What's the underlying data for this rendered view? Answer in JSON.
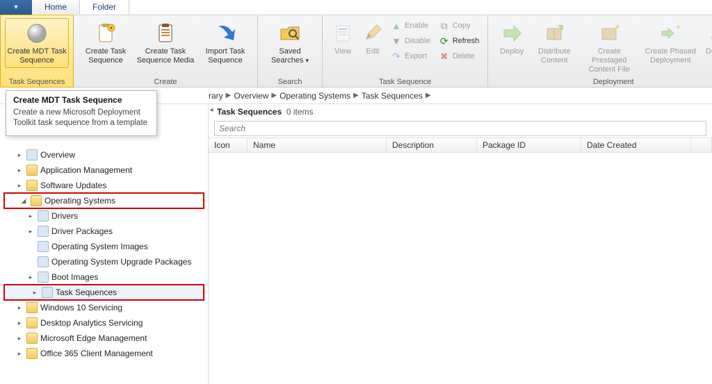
{
  "tabs": {
    "home": "Home",
    "folder": "Folder"
  },
  "ribbon": {
    "groups": {
      "task_sequences": "Task Sequences",
      "create": "Create",
      "search": "Search",
      "task_sequence": "Task Sequence",
      "deployment": "Deployment"
    },
    "buttons": {
      "create_mdt": "Create MDT Task Sequence",
      "create_ts": "Create Task Sequence",
      "create_media": "Create Task Sequence Media",
      "import_ts": "Import Task Sequence",
      "saved_searches": "Saved Searches",
      "view": "View",
      "edit": "Edit",
      "enable": "Enable",
      "disable": "Disable",
      "export": "Export",
      "copy": "Copy",
      "refresh": "Refresh",
      "delete": "Delete",
      "deploy": "Deploy",
      "distribute": "Distribute Content",
      "prestaged": "Create Prestaged Content File",
      "phased": "Create Phased Deployment",
      "debug": "Debug"
    }
  },
  "breadcrumb": [
    "rary",
    "Overview",
    "Operating Systems",
    "Task Sequences"
  ],
  "tooltip": {
    "title": "Create MDT Task Sequence",
    "body": "Create a new Microsoft Deployment Toolkit task sequence from a template"
  },
  "nav": {
    "items": [
      {
        "label": "Overview",
        "depth": 1,
        "icon": "node",
        "exp": "▸"
      },
      {
        "label": "Application Management",
        "depth": 1,
        "icon": "folder",
        "exp": "▸"
      },
      {
        "label": "Software Updates",
        "depth": 1,
        "icon": "folder",
        "exp": "▸"
      },
      {
        "label": "Operating Systems",
        "depth": 1,
        "icon": "folder",
        "exp": "◢",
        "red": true
      },
      {
        "label": "Drivers",
        "depth": 2,
        "icon": "node",
        "exp": "▸"
      },
      {
        "label": "Driver Packages",
        "depth": 2,
        "icon": "node",
        "exp": "▸"
      },
      {
        "label": "Operating System Images",
        "depth": 2,
        "icon": "node",
        "exp": ""
      },
      {
        "label": "Operating System Upgrade Packages",
        "depth": 2,
        "icon": "node",
        "exp": ""
      },
      {
        "label": "Boot Images",
        "depth": 2,
        "icon": "node",
        "exp": "▸"
      },
      {
        "label": "Task Sequences",
        "depth": 2,
        "icon": "node",
        "exp": "▸",
        "selected": true,
        "red": true
      },
      {
        "label": "Windows 10 Servicing",
        "depth": 1,
        "icon": "folder",
        "exp": "▸"
      },
      {
        "label": "Desktop Analytics Servicing",
        "depth": 1,
        "icon": "folder",
        "exp": "▸"
      },
      {
        "label": "Microsoft Edge Management",
        "depth": 1,
        "icon": "folder",
        "exp": "▸"
      },
      {
        "label": "Office 365 Client Management",
        "depth": 1,
        "icon": "folder",
        "exp": "▸"
      }
    ]
  },
  "list": {
    "title": "Task Sequences",
    "count_label": "0 items",
    "search_placeholder": "Search",
    "columns": [
      "Icon",
      "Name",
      "Description",
      "Package ID",
      "Date Created"
    ]
  },
  "icons": {
    "enable_color": "#3a9b3a",
    "disable_color": "#444",
    "refresh_color": "#2a8a2a",
    "delete_color": "#c62020",
    "deploy_color": "#6fbf3a"
  }
}
